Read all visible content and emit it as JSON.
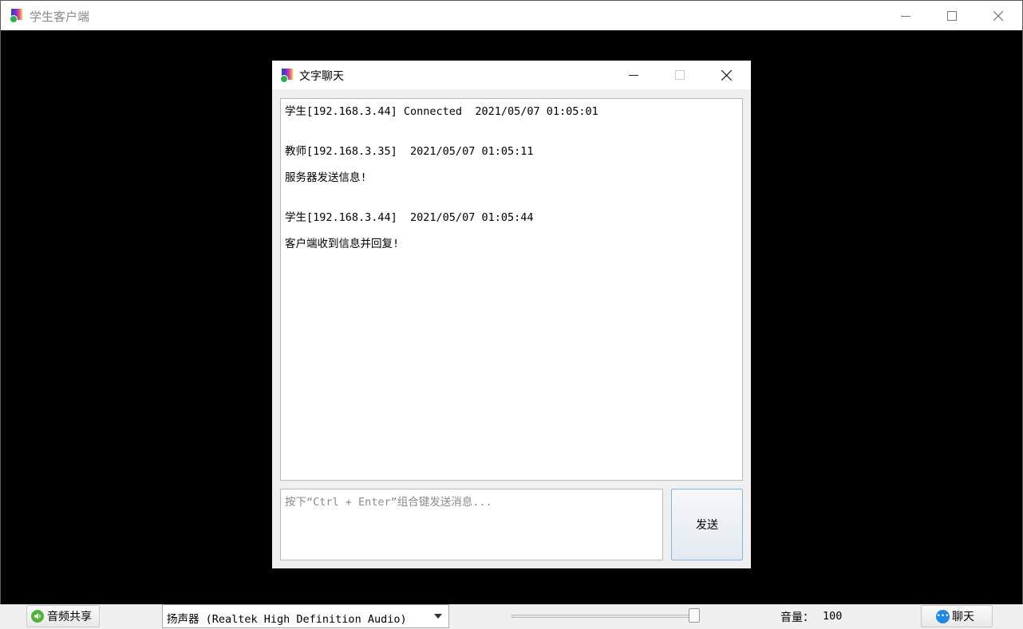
{
  "window": {
    "title": "学生客户端",
    "icon": "app-icon",
    "controls": [
      "minimize-icon",
      "maximize-icon",
      "close-icon"
    ]
  },
  "chat_dialog": {
    "title": "文字聊天",
    "messages": [
      {
        "header": "学生[192.168.3.44] Connected  2021/05/07 01:05:01",
        "body": ""
      },
      {
        "header": "教师[192.168.3.35]  2021/05/07 01:05:11",
        "body": "服务器发送信息!"
      },
      {
        "header": "学生[192.168.3.44]  2021/05/07 01:05:44",
        "body": "客户端收到信息并回复!"
      }
    ],
    "input": {
      "placeholder": "按下“Ctrl + Enter”组合键发送消息...",
      "value": ""
    },
    "send_label": "发送"
  },
  "bottom_bar": {
    "audio_share_label": "音频共享",
    "device_selected": "扬声器 (Realtek High Definition Audio)",
    "volume_label": "音量：",
    "volume_value": "100",
    "volume_level": 100,
    "chat_label": "聊天",
    "colors": {
      "audio_icon": "#4fb43a",
      "chat_icon": "#1e88e5"
    }
  }
}
